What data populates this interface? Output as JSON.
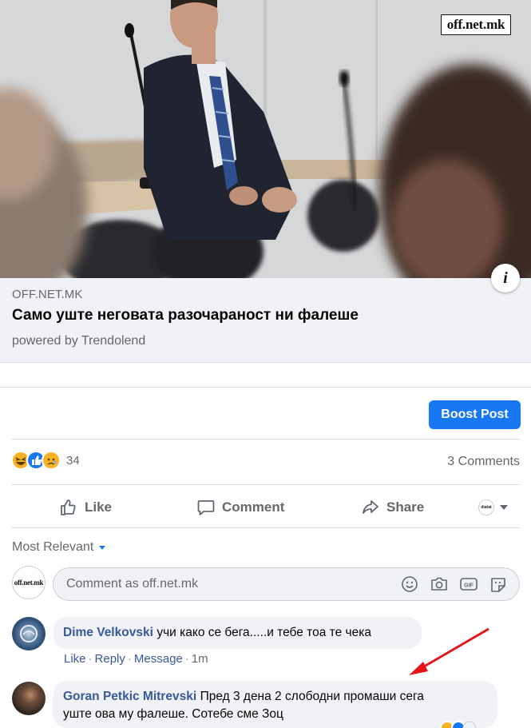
{
  "hero": {
    "watermark": "off.net.mk",
    "info_button": "i"
  },
  "link": {
    "domain": "OFF.NET.MK",
    "title": "Само уште неговата разочараност ни фалеше",
    "subtitle": "powered by Trendolend"
  },
  "boost_button": "Boost Post",
  "reactions": {
    "types": [
      "haha",
      "like",
      "sad"
    ],
    "count": "34"
  },
  "comments_count": "3 Comments",
  "actions": {
    "like": "Like",
    "comment": "Comment",
    "share": "Share"
  },
  "audience_avatar_text": "diatat",
  "sort_label": "Most Relevant",
  "composer": {
    "avatar_text": "off.net.mk",
    "placeholder": "Comment as off.net.mk"
  },
  "comments": [
    {
      "author": "Dime Velkovski",
      "text": "учи како се бега.....и тебе тоа те чека",
      "meta": {
        "like": "Like",
        "reply": "Reply",
        "message": "Message",
        "time": "1m"
      }
    },
    {
      "author": "Goran Petkic Mitrevski",
      "text_line1": "Пред 3 дена 2 слободни промаши сега",
      "text_line2": "уште ова му фалеше. Сотебе сме Зоц"
    }
  ],
  "colors": {
    "accent": "#1877f2",
    "author": "#385898",
    "muted": "#65676b",
    "arrow": "#e8141b"
  }
}
